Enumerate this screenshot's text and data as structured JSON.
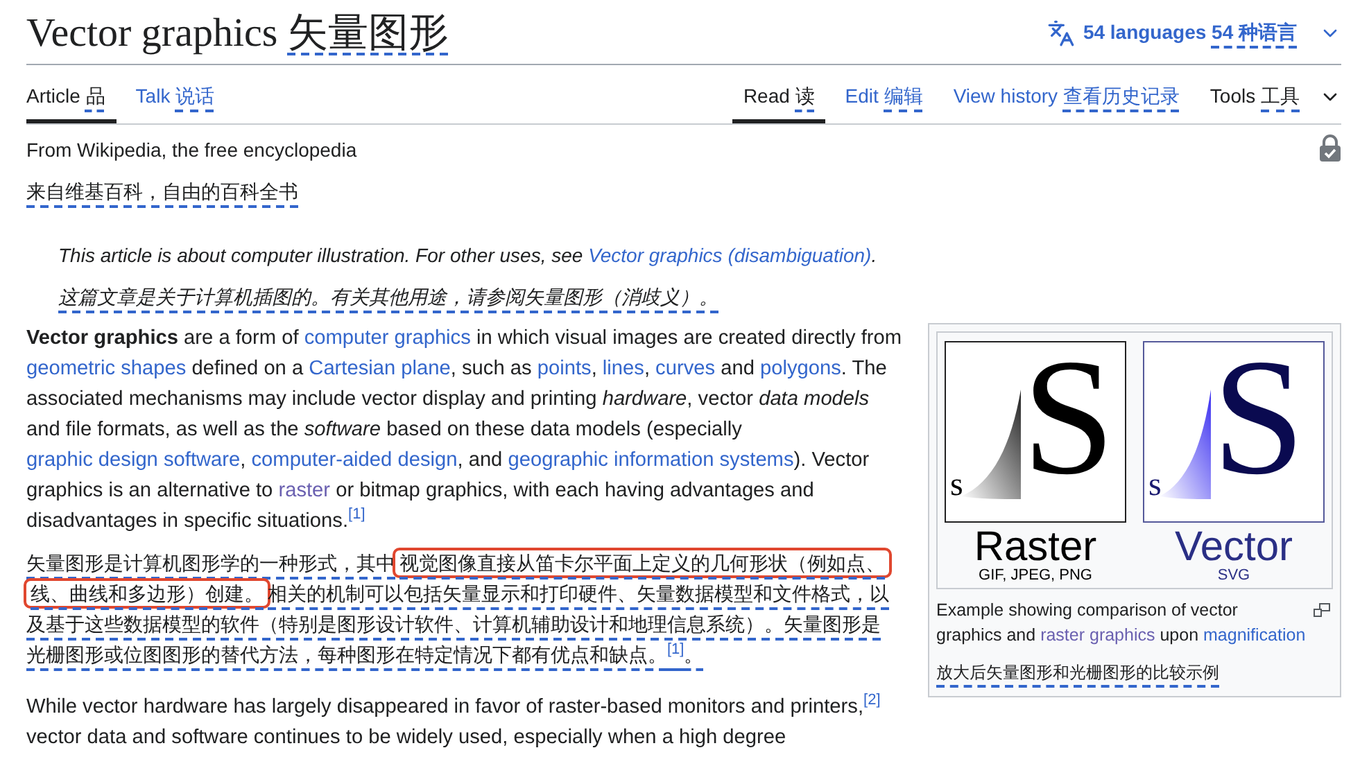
{
  "title": {
    "text": "Vector graphics",
    "translation": "矢量图形"
  },
  "language_button": {
    "label": "54 languages",
    "translation": "54 种语言"
  },
  "left_tabs": [
    {
      "label": "Article",
      "translation": "品",
      "selected": true
    },
    {
      "label": "Talk",
      "translation": "说话",
      "selected": false
    }
  ],
  "right_tabs": [
    {
      "label": "Read",
      "translation": "读",
      "selected": true
    },
    {
      "label": "Edit",
      "translation": "编辑",
      "selected": false
    },
    {
      "label": "View history",
      "translation": "查看历史记录",
      "selected": false
    }
  ],
  "tools_menu": {
    "label": "Tools",
    "translation": "工具"
  },
  "tagline": {
    "text": "From Wikipedia, the free encyclopedia",
    "translation": "来自维基百科，自由的百科全书"
  },
  "hatnote": {
    "segments": [
      {
        "kind": "text",
        "text": "This article is about computer illustration. For other uses, see "
      },
      {
        "kind": "link",
        "text": "Vector graphics (disambiguation)"
      },
      {
        "kind": "text",
        "text": "."
      }
    ],
    "translation": "这篇文章是关于计算机插图的。有关其他用途，请参阅矢量图形（消歧义）。"
  },
  "intro": {
    "segments": [
      {
        "kind": "bold",
        "text": "Vector graphics"
      },
      {
        "kind": "text",
        "text": " are a form of "
      },
      {
        "kind": "link",
        "text": "computer graphics"
      },
      {
        "kind": "text",
        "text": " in which visual images are created directly from "
      },
      {
        "kind": "link",
        "text": "geometric shapes"
      },
      {
        "kind": "text",
        "text": " defined on a "
      },
      {
        "kind": "link",
        "text": "Cartesian plane"
      },
      {
        "kind": "text",
        "text": ", such as "
      },
      {
        "kind": "link",
        "text": "points"
      },
      {
        "kind": "text",
        "text": ", "
      },
      {
        "kind": "link",
        "text": "lines"
      },
      {
        "kind": "text",
        "text": ", "
      },
      {
        "kind": "link",
        "text": "curves"
      },
      {
        "kind": "text",
        "text": " and "
      },
      {
        "kind": "link",
        "text": "polygons"
      },
      {
        "kind": "text",
        "text": ". The associated mechanisms may include vector display and printing "
      },
      {
        "kind": "italic",
        "text": "hardware"
      },
      {
        "kind": "text",
        "text": ", vector "
      },
      {
        "kind": "italic",
        "text": "data models"
      },
      {
        "kind": "text",
        "text": " and file formats, as well as the "
      },
      {
        "kind": "italic",
        "text": "software"
      },
      {
        "kind": "text",
        "text": " based on these data models (especially "
      },
      {
        "kind": "link",
        "text": "graphic design software"
      },
      {
        "kind": "text",
        "text": ", "
      },
      {
        "kind": "link",
        "text": "computer-aided design"
      },
      {
        "kind": "text",
        "text": ", and "
      },
      {
        "kind": "link",
        "text": "geographic information systems"
      },
      {
        "kind": "text",
        "text": "). Vector graphics is an alternative to "
      },
      {
        "kind": "visited_link",
        "text": "raster"
      },
      {
        "kind": "text",
        "text": " or bitmap graphics, with each having advantages and disadvantages in specific situations."
      },
      {
        "kind": "ref",
        "text": "[1]"
      }
    ]
  },
  "intro_translation": {
    "lines": [
      [
        {
          "kind": "text",
          "text": "矢量图形是计算机图形学的一种形式，其中"
        },
        {
          "kind": "highlight",
          "text": "视觉图像直接从笛卡尔平面上定义的几何形状（例如点、"
        }
      ],
      [
        {
          "kind": "highlight",
          "text": "线、曲线和多边形）创建。"
        },
        {
          "kind": "text",
          "text": "相关的机制可以包括矢量显示和打印硬件、矢量数据模型和文件格式，以"
        }
      ],
      [
        {
          "kind": "text",
          "text": "及基于这些数据模型的软件（特别是图形设计软件、计算机辅助设计和地理信息系统）。矢量图形是"
        }
      ],
      [
        {
          "kind": "text",
          "text": "光栅图形或位图图形的替代方法，每种图形在特定情况下都有优点和缺点。"
        },
        {
          "kind": "ref",
          "text": "[1]"
        },
        {
          "kind": "text",
          "text": "。"
        }
      ]
    ]
  },
  "second_paragraph": {
    "segments": [
      {
        "kind": "text",
        "text": "While vector hardware has largely disappeared in favor of raster-based monitors and printers,"
      },
      {
        "kind": "ref",
        "text": "[2]"
      },
      {
        "kind": "text",
        "text": " vector data and software continues to be widely used, especially when a high degree"
      }
    ]
  },
  "figure": {
    "panels": [
      {
        "kind": "raster",
        "big_letter": "S",
        "small_letter": "s",
        "label": "Raster",
        "formats": "GIF, JPEG, PNG"
      },
      {
        "kind": "vector",
        "big_letter": "S",
        "small_letter": "s",
        "label": "Vector",
        "formats": "SVG"
      }
    ],
    "caption": [
      {
        "kind": "text",
        "text": "Example showing comparison of vector graphics and "
      },
      {
        "kind": "visited_link",
        "text": "raster graphics"
      },
      {
        "kind": "text",
        "text": " upon "
      },
      {
        "kind": "link",
        "text": "magnification"
      }
    ],
    "caption_translation": "放大后矢量图形和光栅图形的比较示例"
  }
}
